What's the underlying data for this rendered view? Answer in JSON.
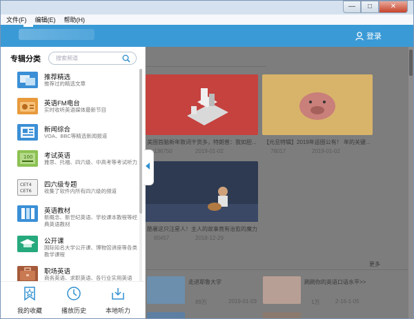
{
  "menu": [
    "文件(F)",
    "编辑(E)",
    "帮助(H)"
  ],
  "window_controls": {
    "minimize": "—",
    "maximize": "□",
    "close": "✕"
  },
  "header": {
    "login_label": "登录",
    "accent_color": "#3a9ad6"
  },
  "sidebar": {
    "title": "专辑分类",
    "search_placeholder": "搜索频道",
    "categories": [
      {
        "name": "推荐精选",
        "desc": "推荐过的精选文章",
        "icon": "featured-icon",
        "color": "#3b8fd6"
      },
      {
        "name": "英语FM电台",
        "desc": "实时收听英语媒体最新节目",
        "icon": "radio-icon",
        "color": "#e89a3c"
      },
      {
        "name": "新闻综合",
        "desc": "VOA、BBC等精选新闻报道",
        "icon": "news-icon",
        "color": "#3b8fd6"
      },
      {
        "name": "考试英语",
        "desc": "雅思、托福、四六级、中高考等考试听力",
        "icon": "exam-icon",
        "color": "#8cc152"
      },
      {
        "name": "四六级专题",
        "desc": "收集了软件内所有四六级的频道",
        "icon": "cet-icon",
        "color": "#d9d9d9"
      },
      {
        "name": "英语教材",
        "desc": "新概念、新世纪英语、学校课本教程等经典英语教材",
        "icon": "textbook-icon",
        "color": "#3b8fd6"
      },
      {
        "name": "公开课",
        "desc": "国际知名大学公开课、博物馆讲座等各类教学课程",
        "icon": "lecture-icon",
        "color": "#26a97c"
      },
      {
        "name": "职场英语",
        "desc": "商务英语、求职英语、各行业实用英语",
        "icon": "briefcase-icon",
        "color": "#a55a3a"
      }
    ],
    "bottom": [
      {
        "label": "我的收藏",
        "icon": "favorites-icon"
      },
      {
        "label": "播放历史",
        "icon": "history-icon"
      },
      {
        "label": "本地听力",
        "icon": "download-icon"
      }
    ]
  },
  "main": {
    "cards": [
      {
        "title": "美国首脑新年致词干货多，特朗普：我如胆...",
        "plays": "136750",
        "date": "2019-01-02"
      },
      {
        "title": "【元旦特辑】2019年运图公有！ 年的关键...",
        "plays": "76017",
        "date": "2019-01-02"
      },
      {
        "title": "酷暑这只汪星人！主人的故事竟有治愈的魔力",
        "plays": "80457",
        "date": "2018-12-29"
      }
    ],
    "more_label": "更多",
    "list": [
      {
        "title": "走进耶鲁大学",
        "plays": "89万",
        "date": "2019-01-03"
      },
      {
        "title": "刷刷你的英语口语水平>>",
        "plays": "1万",
        "date": "2-16-1-05"
      }
    ]
  }
}
